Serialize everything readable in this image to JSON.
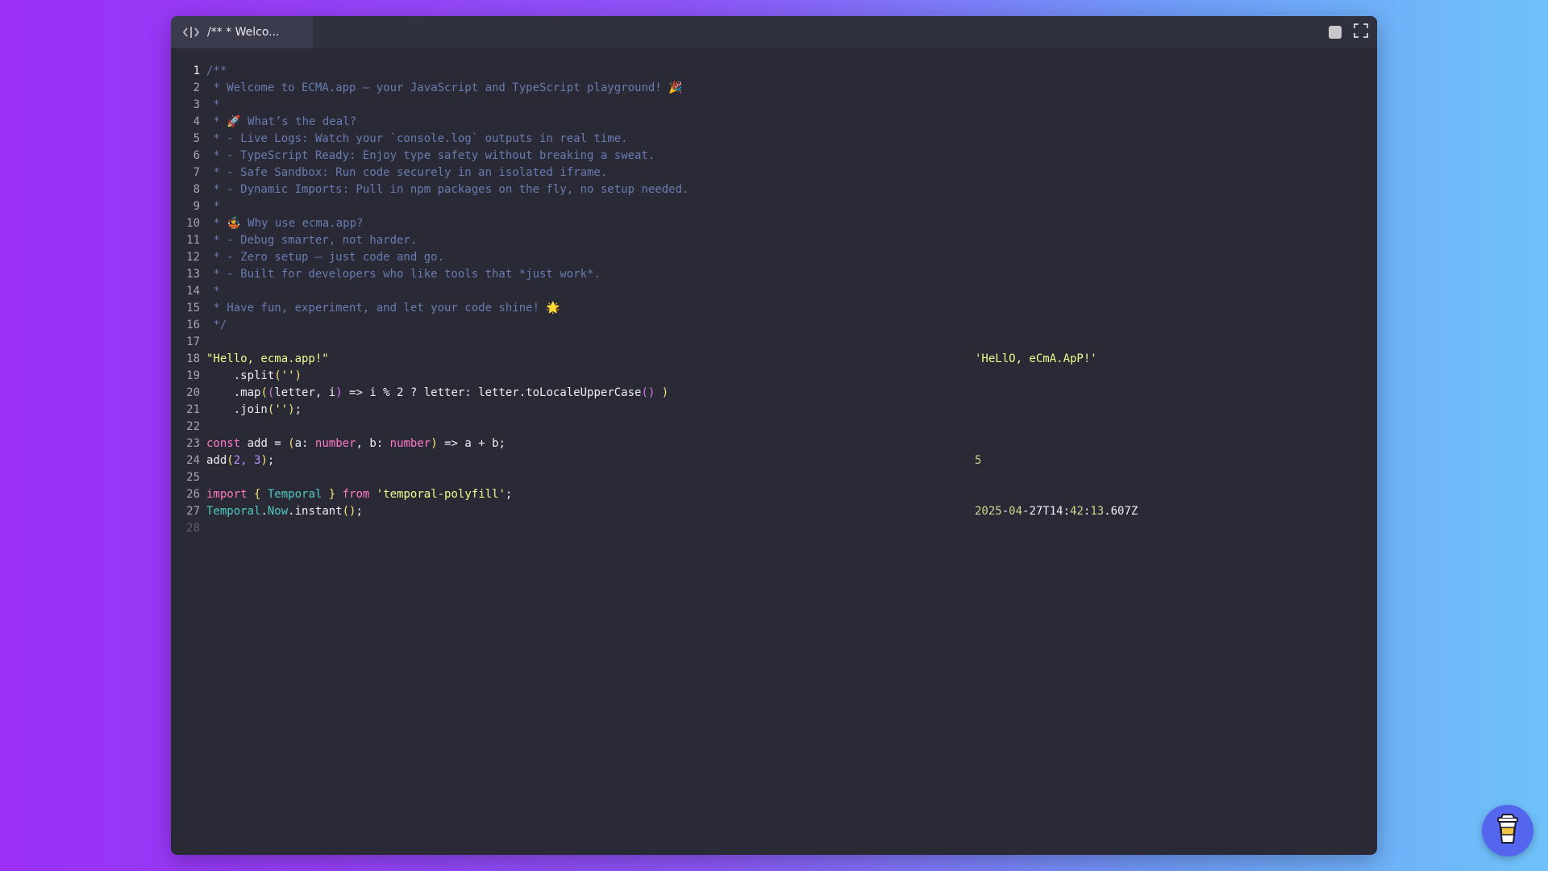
{
  "tab": {
    "title": "/** * Welco...",
    "icon": "code-icon"
  },
  "toolbar": {
    "stop_icon": "stop-icon",
    "fullscreen_icon": "fullscreen-icon"
  },
  "editor": {
    "line_numbers": [
      "1",
      "2",
      "3",
      "4",
      "5",
      "6",
      "7",
      "8",
      "9",
      "10",
      "11",
      "12",
      "13",
      "14",
      "15",
      "16",
      "17",
      "18",
      "19",
      "20",
      "21",
      "22",
      "23",
      "24",
      "25",
      "26",
      "27",
      "28"
    ],
    "active_line": "1",
    "lines": {
      "l1": "/**",
      "l2": " * Welcome to ECMA.app – your JavaScript and TypeScript playground! 🎉",
      "l3": " *",
      "l4": " * 🚀 What’s the deal?",
      "l5": " * - Live Logs: Watch your `console.log` outputs in real time.",
      "l6": " * - TypeScript Ready: Enjoy type safety without breaking a sweat.",
      "l7": " * - Safe Sandbox: Run code securely in an isolated iframe.",
      "l8": " * - Dynamic Imports: Pull in npm packages on the fly, no setup needed.",
      "l9": " *",
      "l10": " * 🤹 Why use ecma.app?",
      "l11": " * - Debug smarter, not harder.",
      "l12": " * - Zero setup – just code and go.",
      "l13": " * - Built for developers who like tools that *just work*.",
      "l14": " *",
      "l15": " * Have fun, experiment, and let your code shine! 🌟",
      "l16": " */",
      "l18": "\"Hello, ecma.app!\"",
      "l19": {
        "indent": "    ",
        "method": ".split",
        "open": "(",
        "arg": "''",
        "close": ")"
      },
      "l20": {
        "indent": "    ",
        "method": ".map",
        "open": "(",
        "open2": "(",
        "params": "letter, i",
        "close2": ")",
        "body": " => i % 2 ? letter: letter.toLocaleUpperCase",
        "call": "()",
        "space": " ",
        "close": ")"
      },
      "l21": {
        "indent": "    ",
        "method": ".join",
        "open": "(",
        "arg": "''",
        "close": ")",
        "semi": ";"
      },
      "l23": {
        "kw": "const",
        "name": " add = ",
        "open": "(",
        "a": "a: ",
        "t1": "number",
        "b": ", b: ",
        "t2": "number",
        "close": ")",
        "rest": " => a + b;"
      },
      "l24": {
        "fn": "add",
        "open": "(",
        "args": "2, 3",
        "close": ")",
        "semi": ";"
      },
      "l26": {
        "kw": "import",
        "sp": " ",
        "ob": "{",
        "cls": " Temporal ",
        "cb": "}",
        "from": " from ",
        "mod": "'temporal-polyfill'",
        "semi": ";"
      },
      "l27": {
        "cls": "Temporal",
        "dot": ".",
        "now": "Now",
        "rest": ".instant",
        "call": "()",
        "semi": ";"
      }
    }
  },
  "output": {
    "o18": "'HeLlO, eCmA.ApP!'",
    "o24": "5",
    "o27": {
      "y": "2025",
      "d1": "-",
      "m": "04",
      "d2": "-27T14",
      "c1": ":",
      "mi": "42",
      "c2": ":",
      "s": "13",
      "dot": ".",
      "ms": "607Z"
    }
  },
  "fab": {
    "icon": "coffee-cup-icon"
  }
}
